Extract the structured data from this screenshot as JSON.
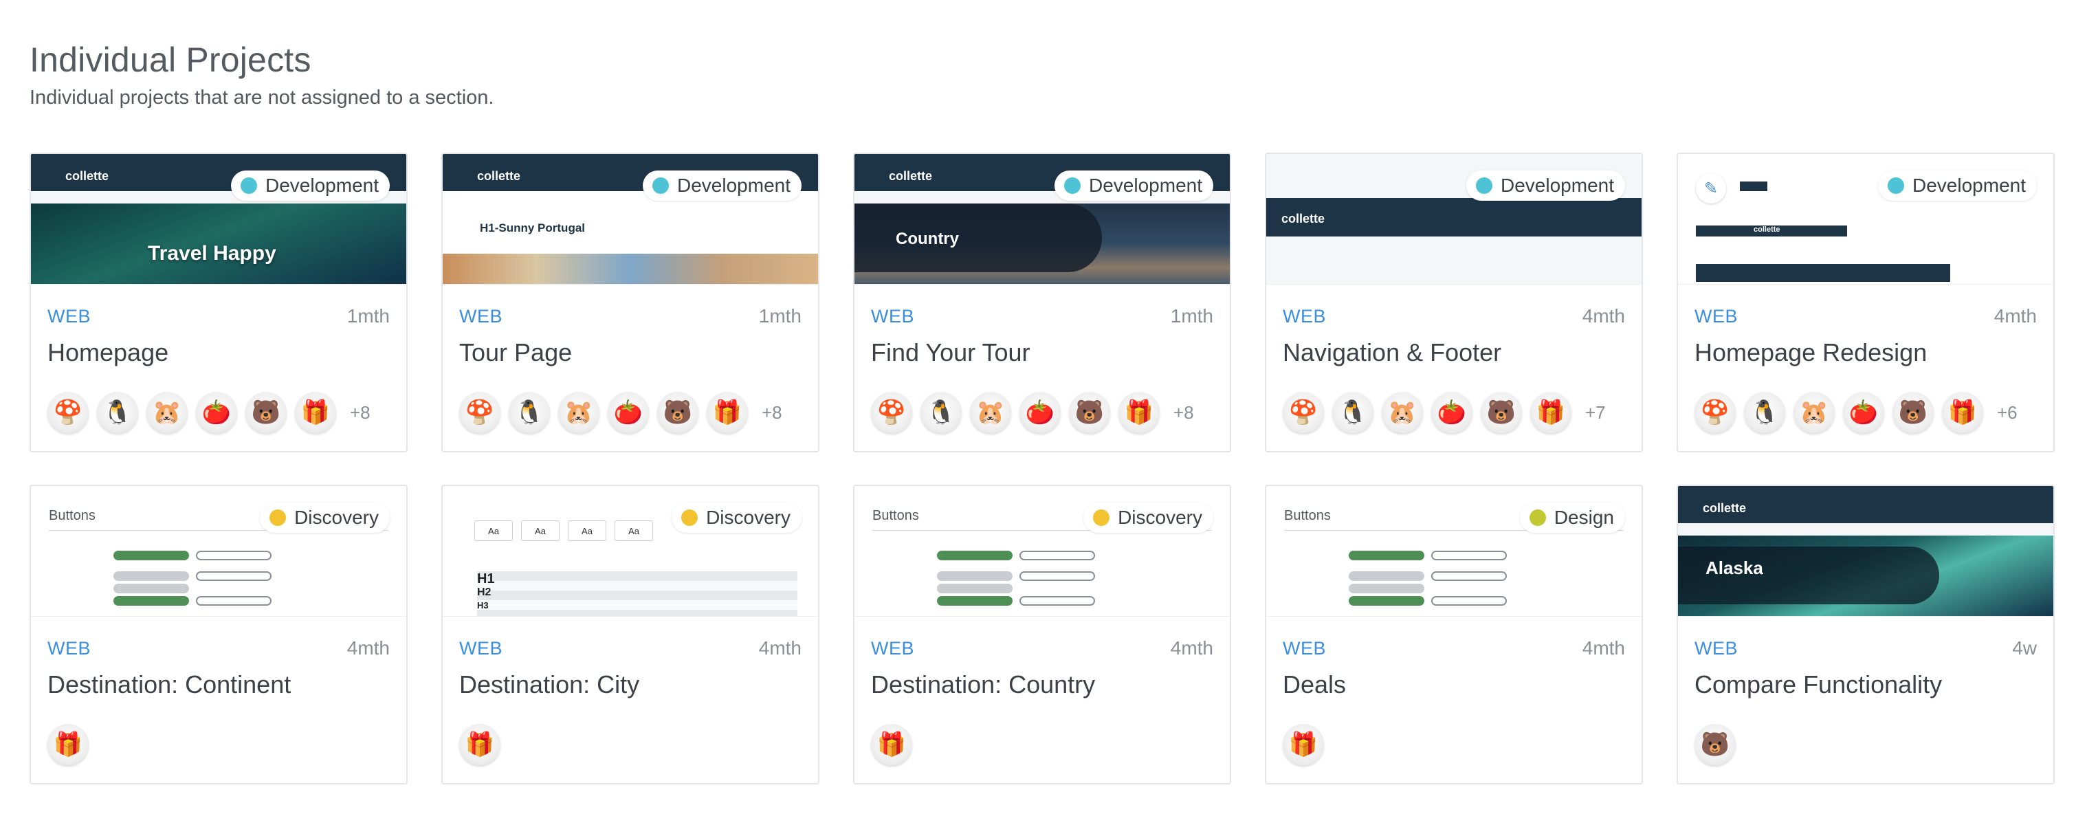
{
  "section": {
    "title": "Individual Projects",
    "subtitle": "Individual projects that are not assigned to a section."
  },
  "colors": {
    "development": "#4ec3d6",
    "discovery": "#f2c230",
    "design": "#c2c832",
    "platform": "#3b8fe0"
  },
  "projects": [
    {
      "title": "Homepage",
      "platform": "WEB",
      "age": "1mth",
      "status": "Development",
      "thumb_text": "Travel Happy",
      "thumb_logo": "collette",
      "avatars": [
        "🍄",
        "🐧",
        "🐹",
        "🍅",
        "🐻",
        "🎁"
      ],
      "more": "+8"
    },
    {
      "title": "Tour Page",
      "platform": "WEB",
      "age": "1mth",
      "status": "Development",
      "thumb_text": "H1-Sunny Portugal",
      "thumb_logo": "collette",
      "avatars": [
        "🍄",
        "🐧",
        "🐹",
        "🍅",
        "🐻",
        "🎁"
      ],
      "more": "+8"
    },
    {
      "title": "Find Your Tour",
      "platform": "WEB",
      "age": "1mth",
      "status": "Development",
      "thumb_text": "Country",
      "thumb_logo": "collette",
      "avatars": [
        "🍄",
        "🐧",
        "🐹",
        "🍅",
        "🐻",
        "🎁"
      ],
      "more": "+8"
    },
    {
      "title": "Navigation & Footer",
      "platform": "WEB",
      "age": "4mth",
      "status": "Development",
      "thumb_logo": "collette",
      "avatars": [
        "🍄",
        "🐧",
        "🐹",
        "🍅",
        "🐻",
        "🎁"
      ],
      "more": "+7"
    },
    {
      "title": "Homepage Redesign",
      "platform": "WEB",
      "age": "4mth",
      "status": "Development",
      "thumb_logo": "collette",
      "avatars": [
        "🍄",
        "🐧",
        "🐹",
        "🍅",
        "🐻",
        "🎁"
      ],
      "more": "+6"
    },
    {
      "title": "Destination: Continent",
      "platform": "WEB",
      "age": "4mth",
      "status": "Discovery",
      "thumb_title": "Buttons",
      "avatars": [
        "🎁"
      ]
    },
    {
      "title": "Destination: City",
      "platform": "WEB",
      "age": "4mth",
      "status": "Discovery",
      "thumb_type": [
        "Aa",
        "Aa",
        "Aa",
        "Aa"
      ],
      "thumb_headings": [
        "H1",
        "H2",
        "H3"
      ],
      "avatars": [
        "🎁"
      ]
    },
    {
      "title": "Destination: Country",
      "platform": "WEB",
      "age": "4mth",
      "status": "Discovery",
      "thumb_title": "Buttons",
      "avatars": [
        "🎁"
      ]
    },
    {
      "title": "Deals",
      "platform": "WEB",
      "age": "4mth",
      "status": "Design",
      "thumb_title": "Buttons",
      "avatars": [
        "🎁"
      ]
    },
    {
      "title": "Compare Functionality",
      "platform": "WEB",
      "age": "4w",
      "status": "",
      "thumb_text": "Alaska",
      "thumb_logo": "collette",
      "avatars": [
        "🐻"
      ]
    }
  ]
}
